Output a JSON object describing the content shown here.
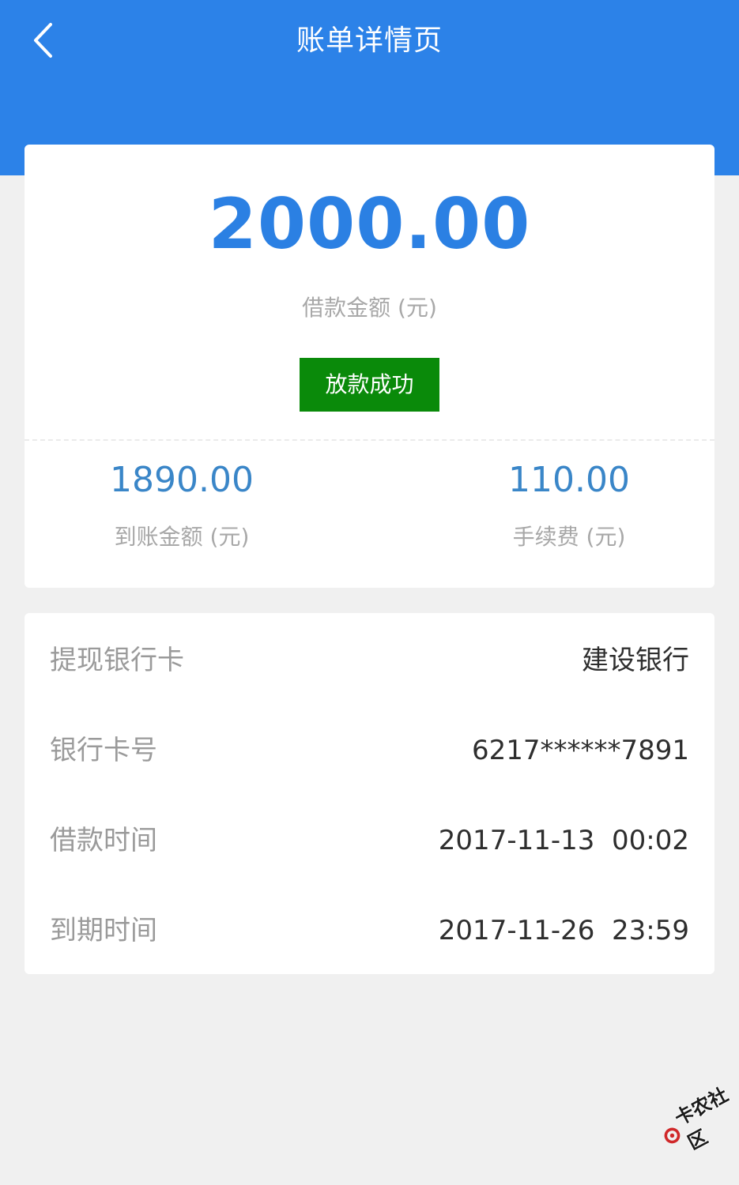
{
  "header": {
    "title": "账单详情页",
    "back_icon": "chevron-left-icon",
    "color": "#2c82e8"
  },
  "summary": {
    "amount": "2000.00",
    "amount_label": "借款金额 (元)",
    "status": "放款成功",
    "status_color": "#0a8a0a",
    "received_amount": "1890.00",
    "received_label": "到账金额 (元)",
    "fee_amount": "110.00",
    "fee_label": "手续费 (元)"
  },
  "details": [
    {
      "label": "提现银行卡",
      "value": "建设银行"
    },
    {
      "label": "银行卡号",
      "value": "6217******7891"
    },
    {
      "label": "借款时间",
      "value": "2017-11-13  00:02"
    },
    {
      "label": "到期时间",
      "value": "2017-11-26  23:59"
    }
  ],
  "watermark": {
    "text": "卡农社区",
    "icon": "logo-icon"
  }
}
